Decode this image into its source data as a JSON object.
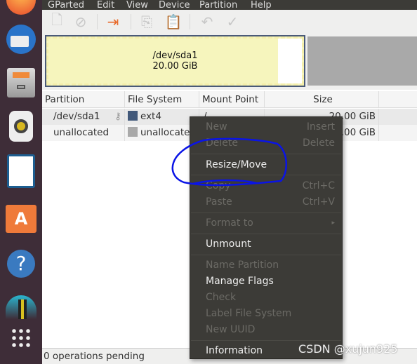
{
  "dock": {
    "items": [
      "firefox-icon",
      "thunderbird-icon",
      "files-icon",
      "rhythmbox-icon",
      "libreoffice-writer-icon",
      "software-center-icon",
      "help-icon",
      "gparted-icon",
      "app-grid-icon"
    ]
  },
  "menubar": {
    "items": [
      "GParted",
      "Edit",
      "View",
      "Device",
      "Partition",
      "Help"
    ]
  },
  "toolbar": {
    "items": [
      "new-icon",
      "delete-icon",
      "resize-move-icon",
      "copy-icon",
      "paste-icon",
      "undo-icon",
      "apply-icon"
    ]
  },
  "graph": {
    "name": "/dev/sda1",
    "size": "20.00 GiB"
  },
  "table": {
    "headers": [
      "Partition",
      "File System",
      "Mount Point",
      "Size"
    ],
    "rows": [
      {
        "partition": "/dev/sda1",
        "fs": "ext4",
        "fs_color": "#42597a",
        "mount": "/",
        "size": "20.00 GiB"
      },
      {
        "partition": "unallocated",
        "fs": "unallocated",
        "fs_color": "#a9a9a9",
        "mount": "",
        "size": "20.00 GiB"
      }
    ]
  },
  "status": "0 operations pending",
  "context_menu": {
    "new": {
      "label": "New",
      "accel": "Insert"
    },
    "delete": {
      "label": "Delete",
      "accel": "Delete"
    },
    "resize": {
      "label": "Resize/Move"
    },
    "copy": {
      "label": "Copy",
      "accel": "Ctrl+C"
    },
    "paste": {
      "label": "Paste",
      "accel": "Ctrl+V"
    },
    "format": {
      "label": "Format to"
    },
    "unmount": {
      "label": "Unmount"
    },
    "name": {
      "label": "Name Partition"
    },
    "flags": {
      "label": "Manage Flags"
    },
    "check": {
      "label": "Check"
    },
    "label_fs": {
      "label": "Label File System"
    },
    "uuid": {
      "label": "New UUID"
    },
    "info": {
      "label": "Information"
    }
  },
  "watermark": "CSDN @xujun925",
  "annotation_color": "#0a14e6"
}
